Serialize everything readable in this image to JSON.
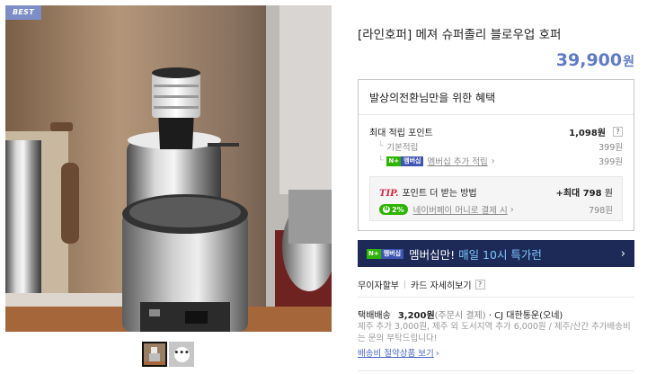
{
  "image": {
    "badge": "BEST",
    "thumbnails": [
      {
        "name": "photo",
        "selected": true
      },
      {
        "name": "video",
        "icon": "ellipsis-icon",
        "selected": false
      }
    ]
  },
  "product": {
    "title": "[라인호퍼] 메져 슈퍼졸리 블로우업 호퍼",
    "price": "39,900",
    "currency": "원"
  },
  "benefits": {
    "header": "발상의전환님만을 위한 혜택",
    "max_points_label": "최대 적립 포인트",
    "max_points_value": "1,098원",
    "help": "?",
    "basic_label": "기본적립",
    "basic_value": "399원",
    "membership_badge_n": "N+",
    "membership_badge_text": "멤버십",
    "membership_extra_label": "멤버십 추가 적립",
    "membership_extra_value": "399원",
    "tip_mark": "TIP.",
    "tip_label": "포인트 더 받는 방법",
    "tip_value": "+최대 798",
    "tip_unit": "원",
    "npay_badge": "2%",
    "npay_label": "네이버페이 머니로 결제 시",
    "npay_value": "798원"
  },
  "membership_banner": {
    "badge_n": "N+",
    "badge_text": "멤버십",
    "text": "멤버십만!",
    "highlight": "매일 10시 특가런"
  },
  "card": {
    "interest_free": "무이자할부",
    "card_benefits": "카드 자세히보기",
    "help": "?"
  },
  "shipping": {
    "label": "택배배송",
    "fee": "3,200원",
    "pay_when": "(주문시 결제)",
    "carrier": "· CJ 대한통운(오네)",
    "note": "제주 추가 3,000원, 제주 외 도서지역 추가 6,000원 / 제주/산간 추가배송비는 문의 부탁드립니다!",
    "link": "배송비 절약상품 보기"
  },
  "colors": {
    "accent": "#5f7bc8",
    "banner_bg": "#1d2a58",
    "banner_highlight": "#7ec8ff",
    "naver_green": "#2db400",
    "link_blue": "#4a67c4",
    "best_badge": "#7d8dc8"
  }
}
